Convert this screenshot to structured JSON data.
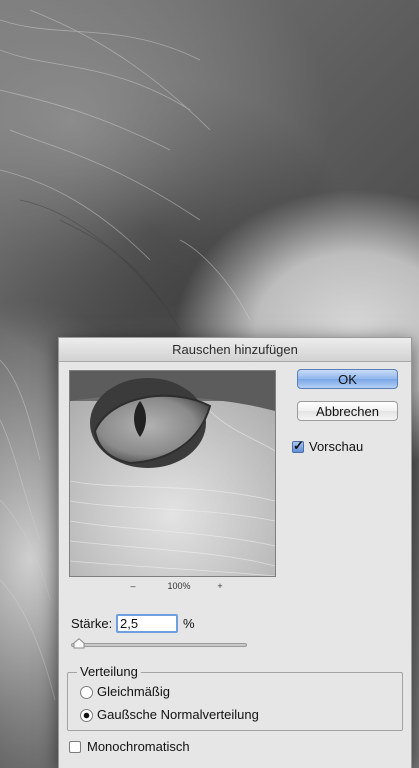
{
  "dialog": {
    "title": "Rauschen hinzufügen",
    "ok_label": "OK",
    "cancel_label": "Abbrechen",
    "preview_label": "Vorschau",
    "preview_checked": true
  },
  "zoom": {
    "minus": "–",
    "level": "100%",
    "plus": "+"
  },
  "amount": {
    "label": "Stärke:",
    "value": "2,5",
    "unit": "%"
  },
  "distribution": {
    "legend": "Verteilung",
    "options": [
      {
        "label": "Gleichmäßig",
        "selected": false
      },
      {
        "label": "Gaußsche Normalverteilung",
        "selected": true
      }
    ]
  },
  "monochrome": {
    "label": "Monochromatisch",
    "checked": false
  },
  "colors": {
    "ok_button": "#8fb6ec",
    "dialog_bg": "#e6e6e6",
    "input_focus": "#6f9fe0"
  },
  "icons": [
    "checkmark-icon",
    "slider-thumb-icon"
  ]
}
